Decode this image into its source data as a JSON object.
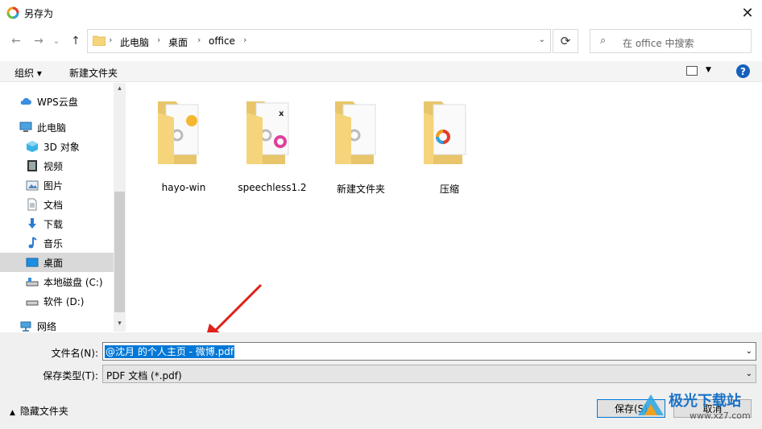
{
  "window": {
    "title": "另存为",
    "close": "✕"
  },
  "nav": {
    "back": "←",
    "forward": "→",
    "history": "⌄",
    "up": "↑"
  },
  "address": {
    "crumbs": [
      "此电脑",
      "桌面",
      "office"
    ],
    "sep": "›",
    "dropdown": "⌄",
    "refresh": "⟳"
  },
  "search": {
    "placeholder": "在 office 中搜索"
  },
  "toolbar": {
    "organize": "组织 ▾",
    "new_folder": "新建文件夹",
    "view_dd": "▼",
    "help": "?"
  },
  "sidebar": {
    "items": [
      {
        "label": "WPS云盘",
        "icon": "cloud-icon"
      },
      {
        "label": "此电脑",
        "icon": "computer-icon"
      },
      {
        "label": "3D 对象",
        "icon": "cube-icon"
      },
      {
        "label": "视频",
        "icon": "video-icon"
      },
      {
        "label": "图片",
        "icon": "picture-icon"
      },
      {
        "label": "文档",
        "icon": "document-icon"
      },
      {
        "label": "下载",
        "icon": "download-icon"
      },
      {
        "label": "音乐",
        "icon": "music-icon"
      },
      {
        "label": "桌面",
        "icon": "desktop-icon",
        "selected": true
      },
      {
        "label": "本地磁盘 (C:)",
        "icon": "drive-icon"
      },
      {
        "label": "软件 (D:)",
        "icon": "drive-icon"
      },
      {
        "label": "网络",
        "icon": "network-icon"
      }
    ],
    "scroll_up": "▴",
    "scroll_down": "▾"
  },
  "folders": [
    {
      "label": "hayo-win"
    },
    {
      "label": "speechless1.2"
    },
    {
      "label": "新建文件夹"
    },
    {
      "label": "压缩"
    }
  ],
  "form": {
    "filename_label": "文件名(N):",
    "filename_value": "@沈月 的个人主页 - 微博.pdf",
    "filetype_label": "保存类型(T):",
    "filetype_value": "PDF 文档 (*.pdf)",
    "dd": "⌄"
  },
  "footer": {
    "hide_folders": "隐藏文件夹",
    "save": "保存(S)",
    "cancel": "取消"
  },
  "watermark": {
    "text": "极光下载站",
    "url": "www.xz7.com"
  },
  "colors": {
    "accent": "#0078d7",
    "folder": "#f5d47c",
    "arrow": "#e0201b",
    "selected": "#d9d9d9"
  }
}
